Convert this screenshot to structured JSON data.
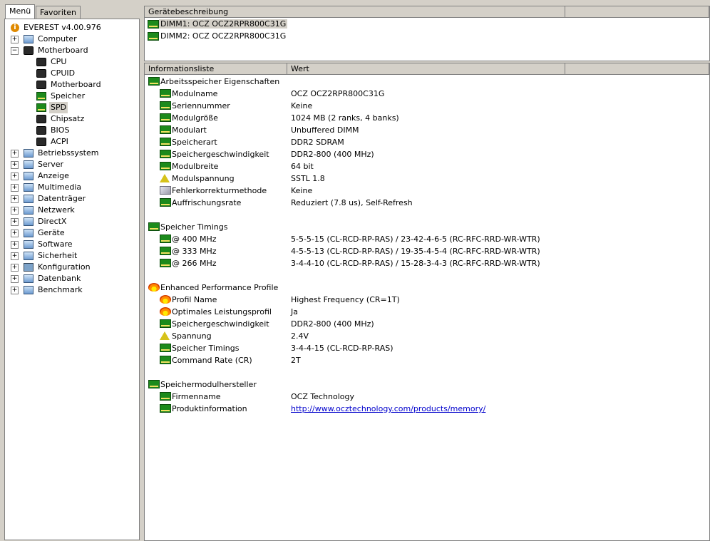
{
  "tabs": {
    "menu": "Menü",
    "favorites": "Favoriten"
  },
  "tree": {
    "root": "EVEREST v4.00.976",
    "items": [
      {
        "label": "Computer",
        "expander": "+",
        "icon": "computer-icon"
      },
      {
        "label": "Motherboard",
        "expander": "−",
        "icon": "motherboard-icon"
      },
      {
        "label": "CPU",
        "expander": "",
        "icon": "cpu-chip-icon"
      },
      {
        "label": "CPUID",
        "expander": "",
        "icon": "cpu-chip-icon"
      },
      {
        "label": "Motherboard",
        "expander": "",
        "icon": "motherboard-icon"
      },
      {
        "label": "Speicher",
        "expander": "",
        "icon": "memory-chip-icon"
      },
      {
        "label": "SPD",
        "expander": "",
        "icon": "ram-module-icon"
      },
      {
        "label": "Chipsatz",
        "expander": "",
        "icon": "chipset-icon"
      },
      {
        "label": "BIOS",
        "expander": "",
        "icon": "bios-chip-icon"
      },
      {
        "label": "ACPI",
        "expander": "",
        "icon": "acpi-chip-icon"
      },
      {
        "label": "Betriebssystem",
        "expander": "+",
        "icon": "windows-icon"
      },
      {
        "label": "Server",
        "expander": "+",
        "icon": "server-icon"
      },
      {
        "label": "Anzeige",
        "expander": "+",
        "icon": "monitor-icon"
      },
      {
        "label": "Multimedia",
        "expander": "+",
        "icon": "speaker-icon"
      },
      {
        "label": "Datenträger",
        "expander": "+",
        "icon": "disk-icon"
      },
      {
        "label": "Netzwerk",
        "expander": "+",
        "icon": "network-globe-icon"
      },
      {
        "label": "DirectX",
        "expander": "+",
        "icon": "directx-icon"
      },
      {
        "label": "Geräte",
        "expander": "+",
        "icon": "devices-icon"
      },
      {
        "label": "Software",
        "expander": "+",
        "icon": "software-icon"
      },
      {
        "label": "Sicherheit",
        "expander": "+",
        "icon": "shield-icon"
      },
      {
        "label": "Konfiguration",
        "expander": "+",
        "icon": "config-icon"
      },
      {
        "label": "Datenbank",
        "expander": "+",
        "icon": "database-icon"
      },
      {
        "label": "Benchmark",
        "expander": "+",
        "icon": "hourglass-icon"
      }
    ]
  },
  "device_panel": {
    "header": "Gerätebeschreibung",
    "items": [
      "DIMM1: OCZ OCZ2RPR800C31G",
      "DIMM2: OCZ OCZ2RPR800C31G"
    ]
  },
  "info_panel": {
    "col_field": "Informationsliste",
    "col_value": "Wert",
    "sections": [
      {
        "title": "Arbeitsspeicher Eigenschaften",
        "icon": "ram-module-icon",
        "rows": [
          {
            "label": "Modulname",
            "value": "OCZ OCZ2RPR800C31G",
            "icon": "ram-module-icon"
          },
          {
            "label": "Seriennummer",
            "value": "Keine",
            "icon": "ram-module-icon"
          },
          {
            "label": "Modulgröße",
            "value": "1024 MB (2 ranks, 4 banks)",
            "icon": "ram-module-icon"
          },
          {
            "label": "Modulart",
            "value": "Unbuffered DIMM",
            "icon": "ram-module-icon"
          },
          {
            "label": "Speicherart",
            "value": "DDR2 SDRAM",
            "icon": "ram-module-icon"
          },
          {
            "label": "Speichergeschwindigkeit",
            "value": "DDR2-800 (400 MHz)",
            "icon": "ram-module-icon"
          },
          {
            "label": "Modulbreite",
            "value": "64 bit",
            "icon": "ram-module-icon"
          },
          {
            "label": "Modulspannung",
            "value": "SSTL 1.8",
            "icon": "voltage-warning-icon"
          },
          {
            "label": "Fehlerkorrekturmethode",
            "value": "Keine",
            "icon": "error-correction-cube-icon"
          },
          {
            "label": "Auffrischungsrate",
            "value": "Reduziert (7.8 us), Self-Refresh",
            "icon": "ram-module-icon"
          }
        ]
      },
      {
        "title": "Speicher Timings",
        "icon": "ram-module-icon",
        "rows": [
          {
            "label": "@ 400 MHz",
            "value": "5-5-5-15  (CL-RCD-RP-RAS) / 23-42-4-6-5  (RC-RFC-RRD-WR-WTR)",
            "icon": "ram-module-icon"
          },
          {
            "label": "@ 333 MHz",
            "value": "4-5-5-13  (CL-RCD-RP-RAS) / 19-35-4-5-4  (RC-RFC-RRD-WR-WTR)",
            "icon": "ram-module-icon"
          },
          {
            "label": "@ 266 MHz",
            "value": "3-4-4-10  (CL-RCD-RP-RAS) / 15-28-3-4-3  (RC-RFC-RRD-WR-WTR)",
            "icon": "ram-module-icon"
          }
        ]
      },
      {
        "title": "Enhanced Performance Profile",
        "icon": "flame-icon",
        "rows": [
          {
            "label": "Profil Name",
            "value": "Highest Frequency (CR=1T)",
            "icon": "flame-icon"
          },
          {
            "label": "Optimales Leistungsprofil",
            "value": "Ja",
            "icon": "flame-icon"
          },
          {
            "label": "Speichergeschwindigkeit",
            "value": "DDR2-800 (400 MHz)",
            "icon": "ram-module-icon"
          },
          {
            "label": "Spannung",
            "value": "2.4V",
            "icon": "voltage-warning-icon"
          },
          {
            "label": "Speicher Timings",
            "value": "3-4-4-15  (CL-RCD-RP-RAS)",
            "icon": "ram-module-icon"
          },
          {
            "label": "Command Rate (CR)",
            "value": "2T",
            "icon": "ram-module-icon"
          }
        ]
      },
      {
        "title": "Speichermodulhersteller",
        "icon": "ram-module-icon",
        "rows": [
          {
            "label": "Firmenname",
            "value": "OCZ Technology",
            "icon": "ram-module-icon"
          },
          {
            "label": "Produktinformation",
            "value": "http://www.ocztechnology.com/products/memory/",
            "icon": "link-ram-icon",
            "link": true
          }
        ]
      }
    ]
  }
}
